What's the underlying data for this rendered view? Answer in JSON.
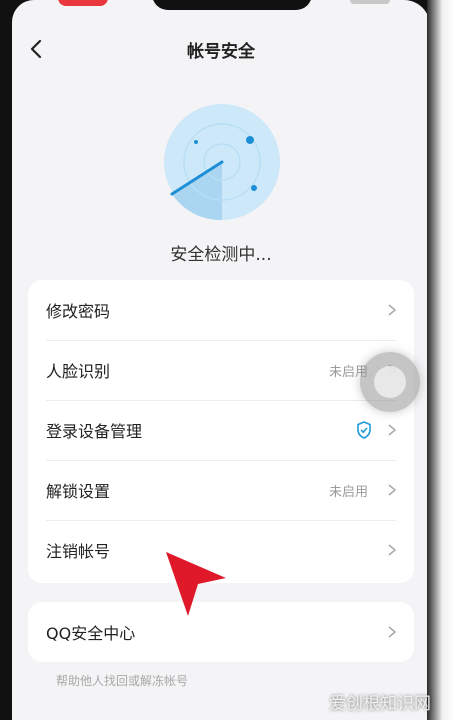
{
  "header": {
    "title": "帐号安全",
    "back_icon": "chevron-left-icon"
  },
  "scan": {
    "status_text": "安全检测中..."
  },
  "settings": {
    "items": [
      {
        "label": "修改密码",
        "status": ""
      },
      {
        "label": "人脸识别",
        "status": "未启用"
      },
      {
        "label": "登录设备管理",
        "status": "",
        "icon": "shield-check-icon"
      },
      {
        "label": "解锁设置",
        "status": "未启用"
      },
      {
        "label": "注销帐号",
        "status": ""
      }
    ]
  },
  "qq_center": {
    "label": "QQ安全中心",
    "hint": "帮助他人找回或解冻帐号"
  },
  "watermark": "爱创根知识网",
  "colors": {
    "radar": "#cde8f8",
    "radar_accent": "#1e8fd6",
    "arrow": "#e0192a",
    "shield": "#1e9bd7"
  }
}
